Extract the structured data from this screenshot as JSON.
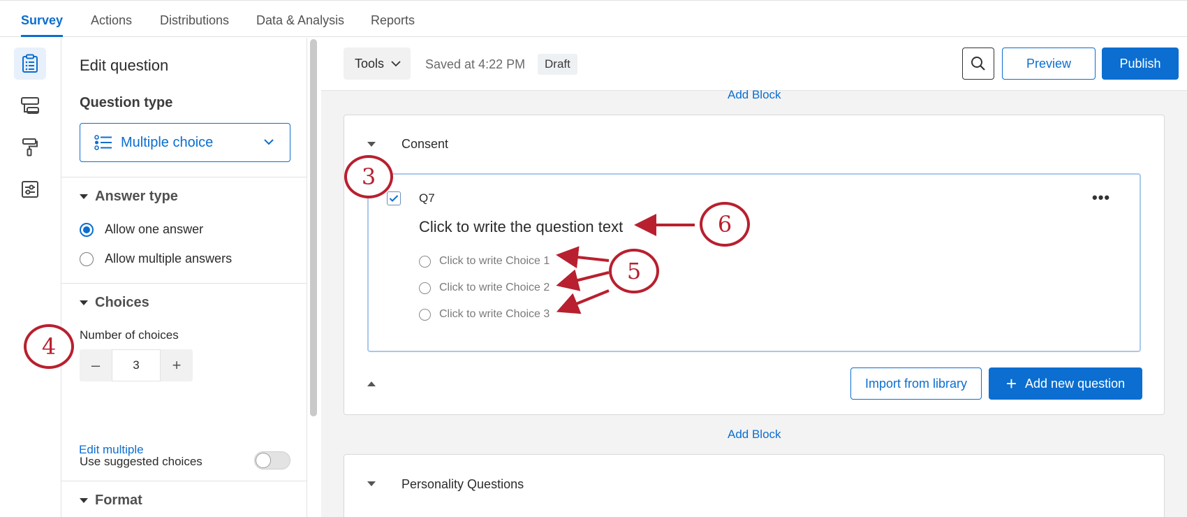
{
  "topnav": {
    "tabs": [
      {
        "label": "Survey",
        "active": true
      },
      {
        "label": "Actions"
      },
      {
        "label": "Distributions"
      },
      {
        "label": "Data & Analysis"
      },
      {
        "label": "Reports"
      }
    ]
  },
  "rail": {
    "icons": [
      "survey-clipboard-icon",
      "survey-flow-icon",
      "look-and-feel-paint-icon",
      "survey-options-icon"
    ]
  },
  "panel": {
    "title": "Edit question",
    "question_type_label": "Question type",
    "question_type_value": "Multiple choice",
    "answer_type_label": "Answer type",
    "answer_options": [
      "Allow one answer",
      "Allow multiple answers"
    ],
    "selected_answer": "Allow one answer",
    "choices_label": "Choices",
    "number_of_choices_label": "Number of choices",
    "number_of_choices": "3",
    "minus": "–",
    "plus": "+",
    "edit_multiple": "Edit multiple",
    "use_suggested_choices": "Use suggested choices",
    "format_label": "Format"
  },
  "toolbar": {
    "tools": "Tools",
    "saved": "Saved at 4:22 PM",
    "draft": "Draft",
    "preview": "Preview",
    "publish": "Publish"
  },
  "editor": {
    "add_block_top": "Add Block",
    "add_block_bottom": "Add Block",
    "block1_title": "Consent",
    "block2_title": "Personality Questions",
    "question": {
      "number": "Q7",
      "text": "Click to write the question text",
      "choices": [
        "Click to write Choice 1",
        "Click to write Choice 2",
        "Click to write Choice 3"
      ],
      "more": "•••"
    },
    "import_from_library": "Import from library",
    "add_new_question": "Add new question"
  },
  "callouts": {
    "c3": "3",
    "c4": "4",
    "c5": "5",
    "c6": "6"
  },
  "colors": {
    "accent": "#0b6ed0",
    "callout": "#b8202f"
  }
}
